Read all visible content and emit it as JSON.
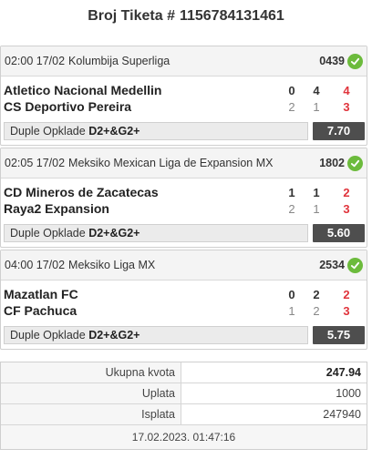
{
  "ticket": {
    "label": "Broj Tiketa #",
    "number": "1156784131461"
  },
  "matches": [
    {
      "time": "02:00 17/02",
      "league": "Kolumbija Superliga",
      "code": "0439",
      "team1": "Atletico Nacional Medellin",
      "team2": "CS Deportivo Pereira",
      "ft1": "0",
      "ft2": "2",
      "ht1": "4",
      "ht2": "1",
      "r1": "4",
      "r2": "3",
      "bet_prefix": "Duple Opklade",
      "bet_pick": "D2+&G2+",
      "odd": "7.70"
    },
    {
      "time": "02:05 17/02",
      "league": "Meksiko Mexican Liga de Expansion MX",
      "code": "1802",
      "team1": "CD Mineros de Zacatecas",
      "team2": "Raya2 Expansion",
      "ft1": "1",
      "ft2": "2",
      "ht1": "1",
      "ht2": "1",
      "r1": "2",
      "r2": "3",
      "bet_prefix": "Duple Opklade",
      "bet_pick": "D2+&G2+",
      "odd": "5.60"
    },
    {
      "time": "04:00 17/02",
      "league": "Meksiko Liga MX",
      "code": "2534",
      "team1": "Mazatlan FC",
      "team2": "CF Pachuca",
      "ft1": "0",
      "ft2": "1",
      "ht1": "2",
      "ht2": "2",
      "r1": "2",
      "r2": "3",
      "bet_prefix": "Duple Opklade",
      "bet_pick": "D2+&G2+",
      "odd": "5.75"
    }
  ],
  "summary": {
    "total_odds_label": "Ukupna kvota",
    "total_odds": "247.94",
    "stake_label": "Uplata",
    "stake": "1000",
    "payout_label": "Isplata",
    "payout": "247940",
    "timestamp": "17.02.2023. 01:47:16"
  },
  "colors": {
    "win_check": "#6cbb3c",
    "red_score": "#e0343c",
    "odd_bg": "#4e4e4e"
  }
}
